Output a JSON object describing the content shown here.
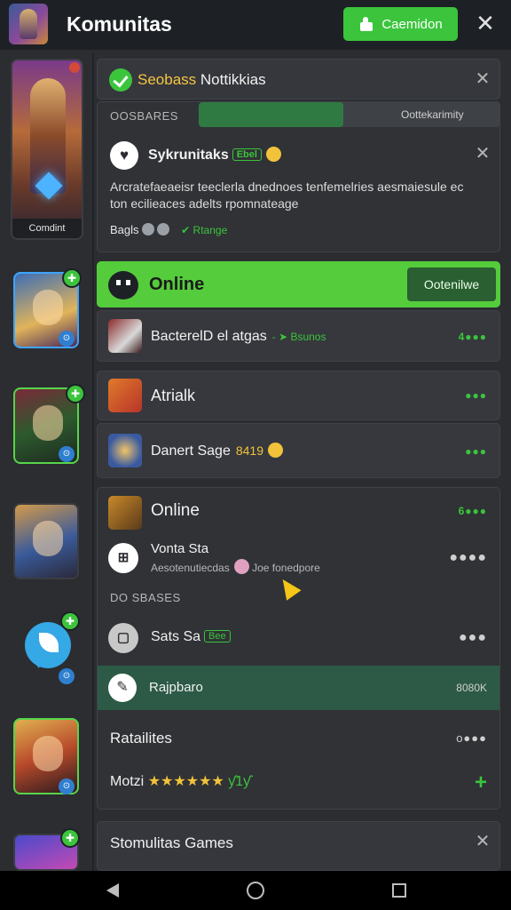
{
  "header": {
    "title": "Komunitas",
    "cta_label": "Caemidon"
  },
  "sidebar": {
    "featured_caption": "Comdint",
    "badges": [
      "✚",
      "✚",
      "✚",
      "✚"
    ],
    "sub_badges": [
      "⊙",
      "⊙",
      "⊙",
      "⊙"
    ]
  },
  "notification": {
    "prefix": "Seobass",
    "title": "Nottikkias"
  },
  "group": {
    "label": "OOSBARES",
    "progress": 0.48,
    "progress_text": "Oottekarimity",
    "post_name": "Sykrunitaks",
    "post_tag": "Ebel",
    "post_text": "Arcratefaeaeisr teeclerla dnednoes tenfemelries aesmaiesule ec ton ecilieaces adelts rpomnateage",
    "tags_label": "Bagls",
    "tags_link": "Rtange"
  },
  "online_bar": {
    "title": "Online",
    "button": "Ootenilwe"
  },
  "rows": [
    {
      "title": "BacterelD el atgas",
      "accent": "Bsunos",
      "dots": "4●●●"
    },
    {
      "title": "Atrialk",
      "dots": "●●●"
    },
    {
      "title": "Danert Sage",
      "accent": "8419",
      "dots": "●●●"
    }
  ],
  "online_section": {
    "title": "Online",
    "count": "6●●●",
    "member_name": "Vonta Sta",
    "member_sub": "Aesotenutiecdas",
    "member_note": "Joe fonedpore",
    "label": "DO SBASES",
    "second_name": "Sats Sa",
    "second_tag": "Bee",
    "reply_label": "Rajpbaro",
    "reply_count": "8080K",
    "results_title": "Ratailites",
    "results_dots": "o●●●",
    "rating_label": "Motzi",
    "rating_stars": "★★★★★★",
    "rating_extra": "ƴ1ƴ"
  },
  "bottom_card": {
    "title": "Stomulitas Games"
  },
  "icons": {
    "close": "close-icon",
    "check": "check-icon",
    "heart": "heart-icon",
    "ghost": "ghost-icon",
    "pen": "pen-icon"
  },
  "colors": {
    "accent": "#3bc43c",
    "panel": "#35373c",
    "bg": "#2b2d31",
    "top": "#1d2126"
  }
}
